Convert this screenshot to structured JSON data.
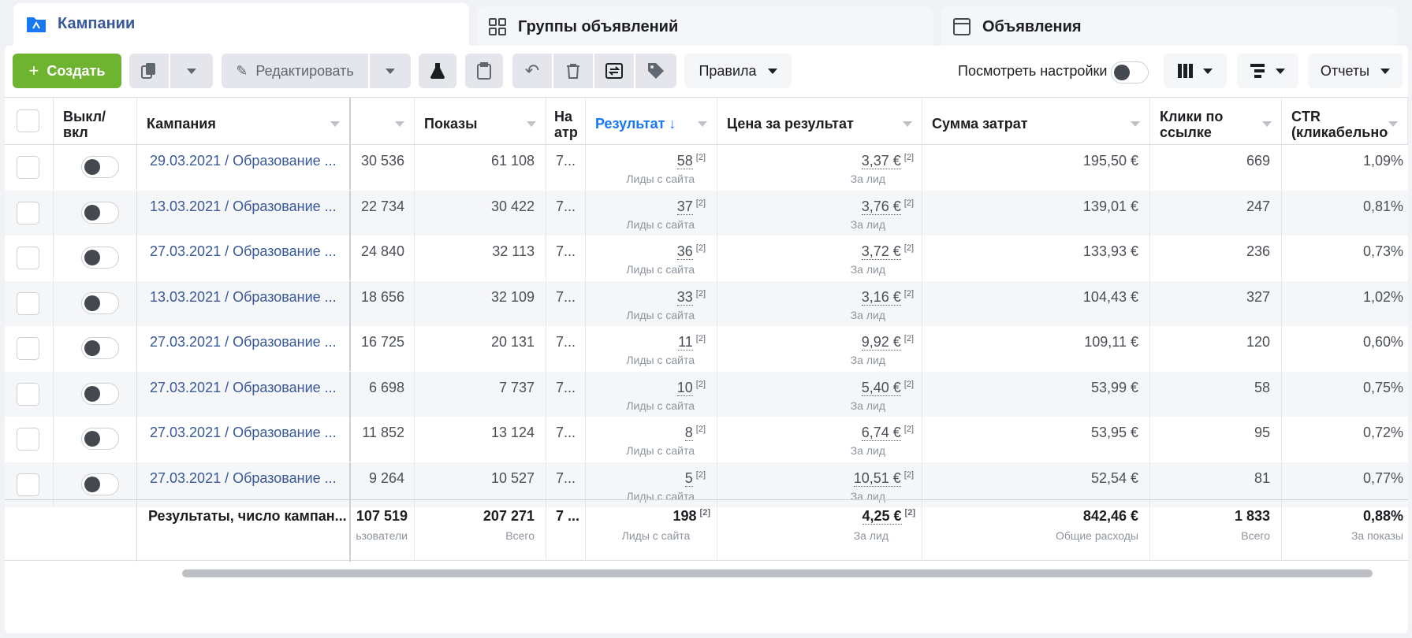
{
  "tabs": [
    {
      "label": "Кампании",
      "icon": "folder-icon"
    },
    {
      "label": "Группы объявлений",
      "icon": "grid-icon"
    },
    {
      "label": "Объявления",
      "icon": "window-icon"
    }
  ],
  "toolbar": {
    "create_label": "Создать",
    "edit_label": "Редактировать",
    "rules_label": "Правила",
    "view_settings_label": "Посмотреть настройки",
    "reports_label": "Отчеты"
  },
  "columns": {
    "toggle": "Выкл/ вкл",
    "campaign": "Кампания",
    "impressions": "Показы",
    "attr": "На атр",
    "result": "Результат ↓",
    "cost_per_result": "Цена за результат",
    "spend": "Сумма затрат",
    "link_clicks": "Клики по ссылке",
    "ctr": "CTR (кликабельность"
  },
  "rows": [
    {
      "campaign": "29.03.2021 / Образование ...",
      "reach": "30 536",
      "impressions": "61 108",
      "attr": "7...",
      "result": "58",
      "result_sub": "Лиды с сайта",
      "cost": "3,37 €",
      "cost_sub": "За лид",
      "spend": "195,50 €",
      "clicks": "669",
      "ctr": "1,09%"
    },
    {
      "campaign": "13.03.2021 / Образование ...",
      "reach": "22 734",
      "impressions": "30 422",
      "attr": "7...",
      "result": "37",
      "result_sub": "Лиды с сайта",
      "cost": "3,76 €",
      "cost_sub": "За лид",
      "spend": "139,01 €",
      "clicks": "247",
      "ctr": "0,81%"
    },
    {
      "campaign": "27.03.2021 / Образование ...",
      "reach": "24 840",
      "impressions": "32 113",
      "attr": "7...",
      "result": "36",
      "result_sub": "Лиды с сайта",
      "cost": "3,72 €",
      "cost_sub": "За лид",
      "spend": "133,93 €",
      "clicks": "236",
      "ctr": "0,73%"
    },
    {
      "campaign": "13.03.2021 / Образование ...",
      "reach": "18 656",
      "impressions": "32 109",
      "attr": "7...",
      "result": "33",
      "result_sub": "Лиды с сайта",
      "cost": "3,16 €",
      "cost_sub": "За лид",
      "spend": "104,43 €",
      "clicks": "327",
      "ctr": "1,02%"
    },
    {
      "campaign": "27.03.2021 / Образование ...",
      "reach": "16 725",
      "impressions": "20 131",
      "attr": "7...",
      "result": "11",
      "result_sub": "Лиды с сайта",
      "cost": "9,92 €",
      "cost_sub": "За лид",
      "spend": "109,11 €",
      "clicks": "120",
      "ctr": "0,60%"
    },
    {
      "campaign": "27.03.2021 / Образование ...",
      "reach": "6 698",
      "impressions": "7 737",
      "attr": "7...",
      "result": "10",
      "result_sub": "Лиды с сайта",
      "cost": "5,40 €",
      "cost_sub": "За лид",
      "spend": "53,99 €",
      "clicks": "58",
      "ctr": "0,75%"
    },
    {
      "campaign": "27.03.2021 / Образование ...",
      "reach": "11 852",
      "impressions": "13 124",
      "attr": "7...",
      "result": "8",
      "result_sub": "Лиды с сайта",
      "cost": "6,74 €",
      "cost_sub": "За лид",
      "spend": "53,95 €",
      "clicks": "95",
      "ctr": "0,72%"
    },
    {
      "campaign": "27.03.2021 / Образование ...",
      "reach": "9 264",
      "impressions": "10 527",
      "attr": "7...",
      "result": "5",
      "result_sub": "Лиды с сайта",
      "cost": "10,51 €",
      "cost_sub": "За лид",
      "spend": "52,54 €",
      "clicks": "81",
      "ctr": "0,77%"
    }
  ],
  "footnote": "[2]",
  "summary": {
    "label": "Результаты, число кампан...",
    "reach": "107 519",
    "reach_sub": "ьзователи",
    "impressions": "207 271",
    "impressions_sub": "Всего",
    "attr": "7 ...",
    "result": "198",
    "result_sub": "Лиды с сайта",
    "cost": "4,25 €",
    "cost_sub": "За лид",
    "spend": "842,46 €",
    "spend_sub": "Общие расходы",
    "clicks": "1 833",
    "clicks_sub": "Всего",
    "ctr": "0,88%",
    "ctr_sub": "За показы"
  },
  "colors": {
    "link": "#385898",
    "create": "#6fb431",
    "active_tab": "#385898"
  }
}
